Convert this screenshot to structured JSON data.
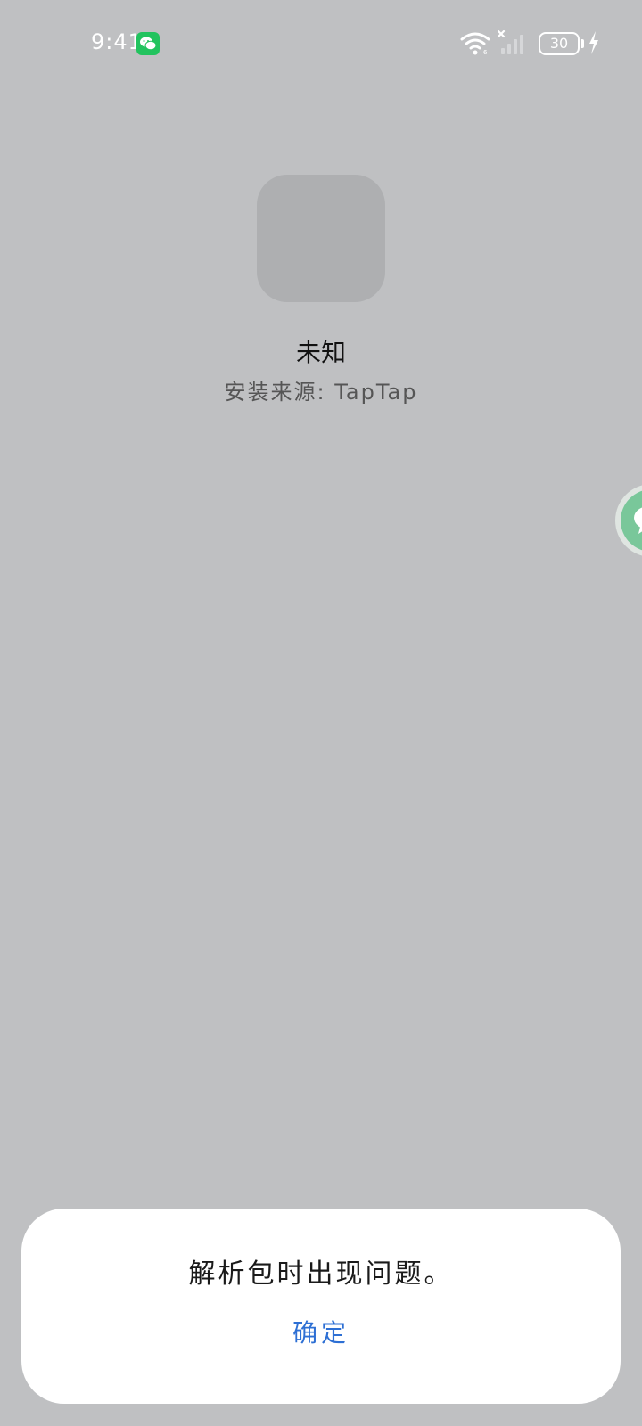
{
  "status_bar": {
    "time": "9:41",
    "battery_level": "30",
    "notification_icon": "wechat-icon",
    "icons": [
      "wifi-icon",
      "signal-icon",
      "battery-icon",
      "charging-bolt-icon"
    ]
  },
  "app": {
    "name": "未知",
    "install_source": "安装来源: TapTap"
  },
  "floating_bubble": {
    "icon": "chat-bubble-icon",
    "color": "#79c79a"
  },
  "dialog": {
    "message": "解析包时出现问题。",
    "confirm_label": "确定",
    "confirm_color": "#2d6fd4"
  }
}
